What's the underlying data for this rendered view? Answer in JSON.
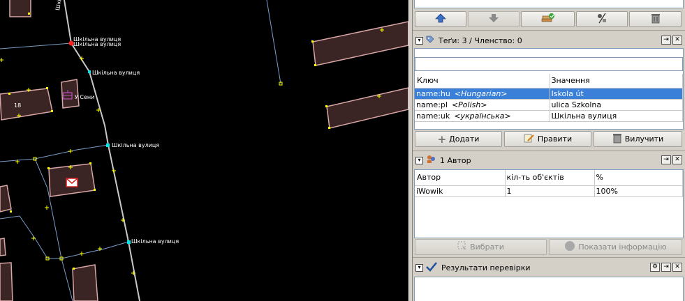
{
  "map": {
    "street_labels": [
      "Шкільна вулиця",
      "Шкільна вулиця",
      "Шкільна вулиця",
      "Шкільна вулиця",
      "Шкільна вулиця"
    ],
    "house_number": "18",
    "poi_label": "У Сени",
    "vertical_street_label": "Шкільна вул",
    "colors": {
      "road": "#c8c8c8",
      "footway": "#7a9cc8",
      "building_fill": "#3a2424",
      "building_stroke": "#d9a6a6",
      "node": "#ffff00",
      "selected_node": "#00e5e5",
      "junction": "#ff2020"
    }
  },
  "toolbar": {
    "buttons": [
      {
        "icon": "arrow-up-icon"
      },
      {
        "icon": "arrow-down-icon"
      },
      {
        "icon": "layers-check-icon"
      },
      {
        "icon": "tag-edit-icon"
      },
      {
        "icon": "trash-icon"
      }
    ]
  },
  "tags": {
    "title": "Теґи: 3 / Членство: 0",
    "filter_value": "",
    "columns": [
      "Ключ",
      "Значення"
    ],
    "rows": [
      {
        "key": "name:hu",
        "lang": "<Hungarian>",
        "value": "Iskola út",
        "selected": true
      },
      {
        "key": "name:pl",
        "lang": "<Polish>",
        "value": "ulica Szkolna",
        "selected": false
      },
      {
        "key": "name:uk",
        "lang": "<українська>",
        "value": "Шкільна вулиця",
        "selected": false
      }
    ],
    "add_label": "Додати",
    "edit_label": "Правити",
    "delete_label": "Вилучити"
  },
  "authors": {
    "title": "1 Автор",
    "columns": [
      "Автор",
      "кіл-ть об'єктів",
      "%"
    ],
    "rows": [
      {
        "author": "iWowik",
        "count": "1",
        "percent": "100%"
      }
    ],
    "select_label": "Вибрати",
    "info_label": "Показати інформацію"
  },
  "validation": {
    "title": "Результати перевірки"
  }
}
